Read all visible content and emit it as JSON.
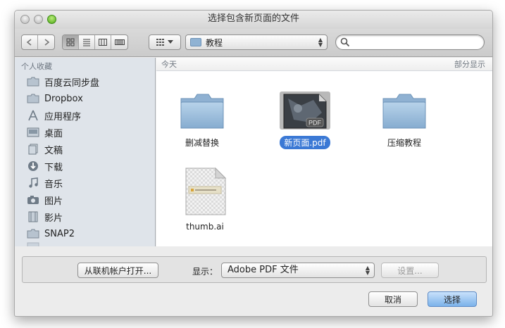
{
  "window": {
    "title": "选择包含新页面的文件"
  },
  "toolbar": {
    "location": "教程",
    "search_placeholder": ""
  },
  "sidebar": {
    "header": "个人收藏",
    "items": [
      {
        "label": "百度云同步盘",
        "icon": "folder-icon"
      },
      {
        "label": "Dropbox",
        "icon": "folder-icon"
      },
      {
        "label": "应用程序",
        "icon": "applications-icon"
      },
      {
        "label": "桌面",
        "icon": "desktop-icon"
      },
      {
        "label": "文稿",
        "icon": "documents-icon"
      },
      {
        "label": "下载",
        "icon": "downloads-icon"
      },
      {
        "label": "音乐",
        "icon": "music-icon"
      },
      {
        "label": "图片",
        "icon": "pictures-icon"
      },
      {
        "label": "影片",
        "icon": "movies-icon"
      },
      {
        "label": "SNAP2",
        "icon": "folder-icon"
      }
    ]
  },
  "content": {
    "section_title": "今天",
    "section_toggle": "部分显示",
    "files": [
      {
        "name": "删减替换",
        "type": "folder"
      },
      {
        "name": "新页面.pdf",
        "type": "pdf",
        "selected": true,
        "badge": "PDF"
      },
      {
        "name": "压缩教程",
        "type": "folder"
      },
      {
        "name": "thumb.ai",
        "type": "ai"
      }
    ]
  },
  "footer": {
    "online_button": "从联机帐户打开...",
    "show_label": "显示：",
    "format_value": "Adobe PDF 文件",
    "settings_button": "设置...",
    "cancel_button": "取消",
    "choose_button": "选择"
  },
  "colors": {
    "selection": "#3b79d5",
    "sidebar_bg": "#dfe4ea",
    "folder_blue": "#9cc0e0"
  }
}
